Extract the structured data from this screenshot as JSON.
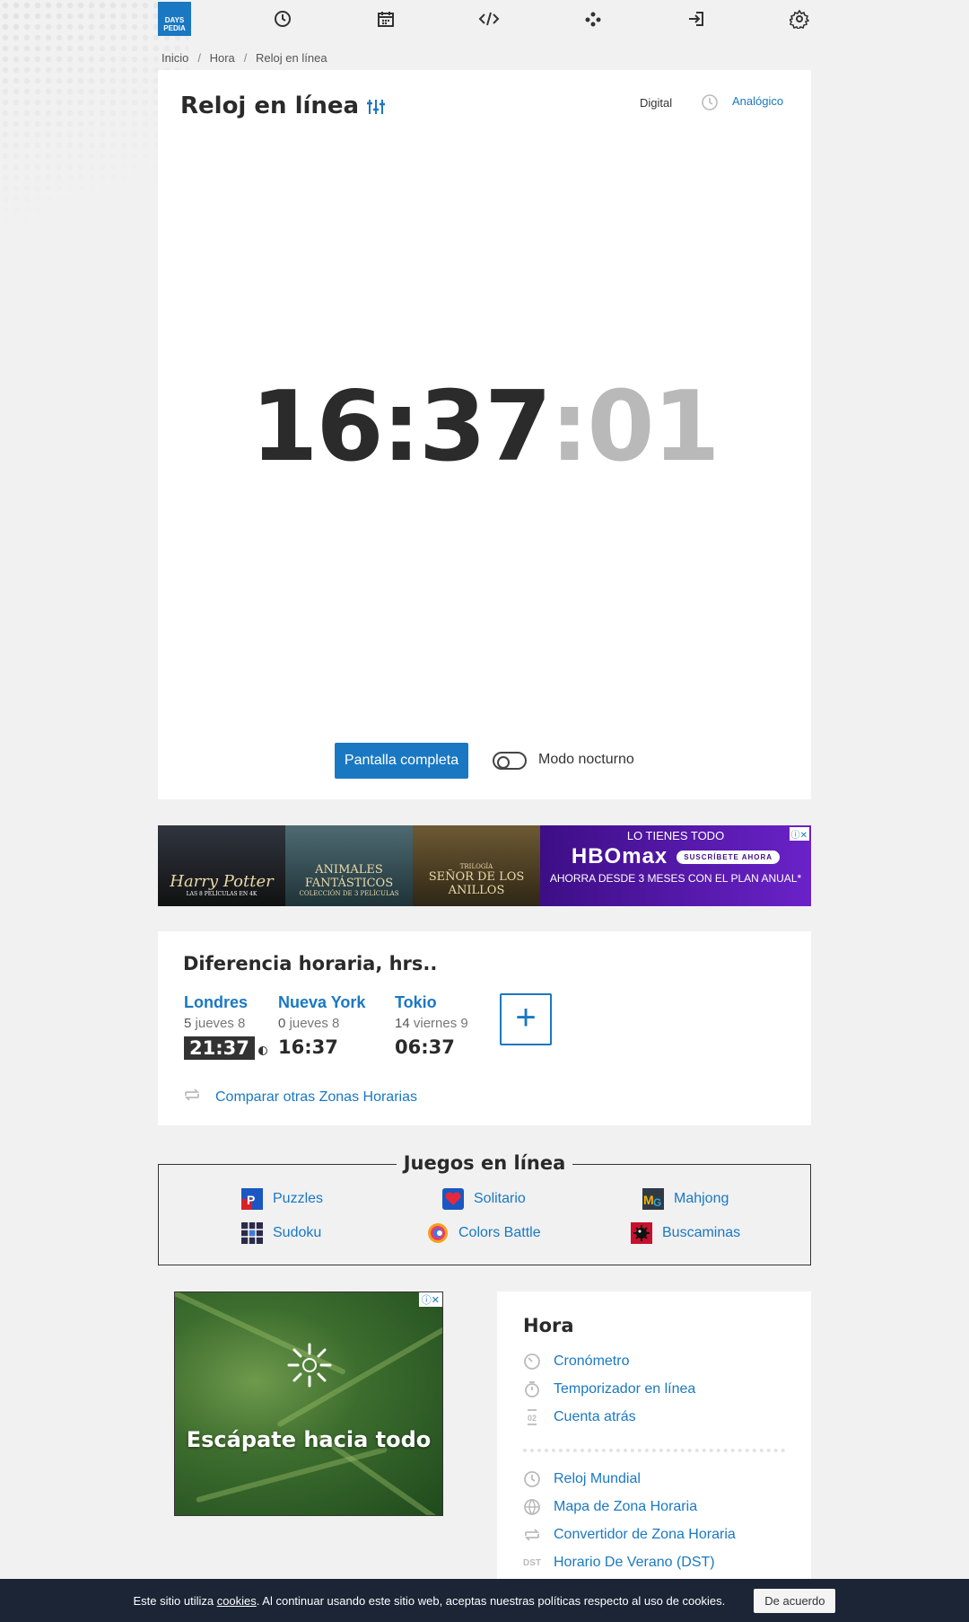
{
  "nav": {
    "logo_line1": "DAYS",
    "logo_line2": "PEDIA",
    "icons": [
      "clock-icon",
      "calendar-icon",
      "code-icon",
      "games-icon",
      "login-icon",
      "settings-icon"
    ]
  },
  "breadcrumb": [
    "Inicio",
    "Hora",
    "Reloj en línea"
  ],
  "clock": {
    "title": "Reloj en línea",
    "mode_digital": "Digital",
    "mode_analog": "Analógico",
    "time_hm": "16:37",
    "time_sec": ":01",
    "fullscreen_label": "Pantalla completa",
    "night_mode_label": "Modo nocturno",
    "night_mode_on": false
  },
  "ad_banner": {
    "poster1": "Harry Potter",
    "poster1_sub": "LAS 8 PELÍCULAS EN 4K",
    "poster2": "ANIMALES FANTÁSTICOS",
    "poster2_sub": "COLECCIÓN DE 3 PELÍCULAS",
    "poster3": "SEÑOR DE LOS ANILLOS",
    "poster3_sub": "TRILOGÍA",
    "line1": "LO TIENES TODO",
    "logo": "HBOmax",
    "cta": "SUSCRÍBETE AHORA",
    "line3": "AHORRA DESDE 3 MESES CON EL PLAN ANUAL*"
  },
  "time_diff": {
    "title": "Diferencia horaria, hrs..",
    "cities": [
      {
        "name": "Londres",
        "offset": "5",
        "day": "jueves 8",
        "time": "21:37",
        "night": true
      },
      {
        "name": "Nueva York",
        "offset": "0",
        "day": "jueves 8",
        "time": "16:37",
        "night": false
      },
      {
        "name": "Tokio",
        "offset": "14",
        "day": "viernes 9",
        "time": "06:37",
        "night": false
      }
    ],
    "add_label": "+",
    "compare_label": "Comparar otras Zonas Horarias"
  },
  "games": {
    "title": "Juegos en línea",
    "items": [
      "Puzzles",
      "Solitario",
      "Mahjong",
      "Sudoku",
      "Colors Battle",
      "Buscaminas"
    ]
  },
  "ad2": {
    "text": "Escápate hacia todo"
  },
  "sidebar": {
    "title": "Hora",
    "group1": [
      "Cronómetro",
      "Temporizador en línea",
      "Cuenta atrás"
    ],
    "group2": [
      "Reloj Mundial",
      "Mapa de Zona Horaria",
      "Convertidor de Zona Horaria",
      "Horario De Verano (DST)"
    ],
    "dst_badge": "DST"
  },
  "cookie": {
    "pre": "Este sitio utiliza ",
    "link": "cookies",
    "post": ". Al continuar usando este sitio web, aceptas nuestras políticas respecto al uso de cookies.",
    "button": "De acuerdo"
  },
  "colors": {
    "accent": "#1a78c2",
    "dark": "#2b2b2b",
    "cookie_bg": "#1b2536"
  }
}
